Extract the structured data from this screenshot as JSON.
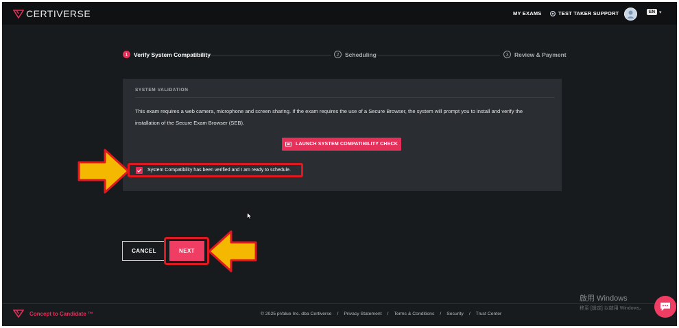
{
  "header": {
    "brand": "CERTIVERSE",
    "nav": {
      "my_exams": "MY EXAMS",
      "support": "TEST TAKER SUPPORT"
    },
    "language": "EN"
  },
  "stepper": [
    {
      "number": "1",
      "label": "Verify System Compatibility",
      "active": true
    },
    {
      "number": "2",
      "label": "Scheduling",
      "active": false
    },
    {
      "number": "3",
      "label": "Review & Payment",
      "active": false
    }
  ],
  "validation": {
    "title": "SYSTEM VALIDATION",
    "description": "This exam requires a web camera, microphone and screen sharing. If the exam requires the use of a Secure Browser, the system will prompt you to install and verify the installation of the Secure Exam Browser (SEB).",
    "launch_label": "LAUNCH SYSTEM COMPATIBILITY CHECK",
    "checkbox_label": "System Compatibility has been verified and I am ready to schedule.",
    "checkbox_checked": true
  },
  "actions": {
    "cancel": "CANCEL",
    "next": "NEXT"
  },
  "footer": {
    "tagline": "Concept to Candidate ™",
    "links": [
      "© 2025 pValue Inc. dba Certiverse",
      "Privacy Statement",
      "Terms & Conditions",
      "Security",
      "Trust Center"
    ]
  },
  "watermark": {
    "title": "啟用 Windows",
    "subtitle": "移至 [設定] 以啟用 Windows。"
  },
  "colors": {
    "accent": "#e5305a",
    "highlight": "#e01820",
    "arrow": "#f5b800",
    "background": "#181b1e"
  }
}
